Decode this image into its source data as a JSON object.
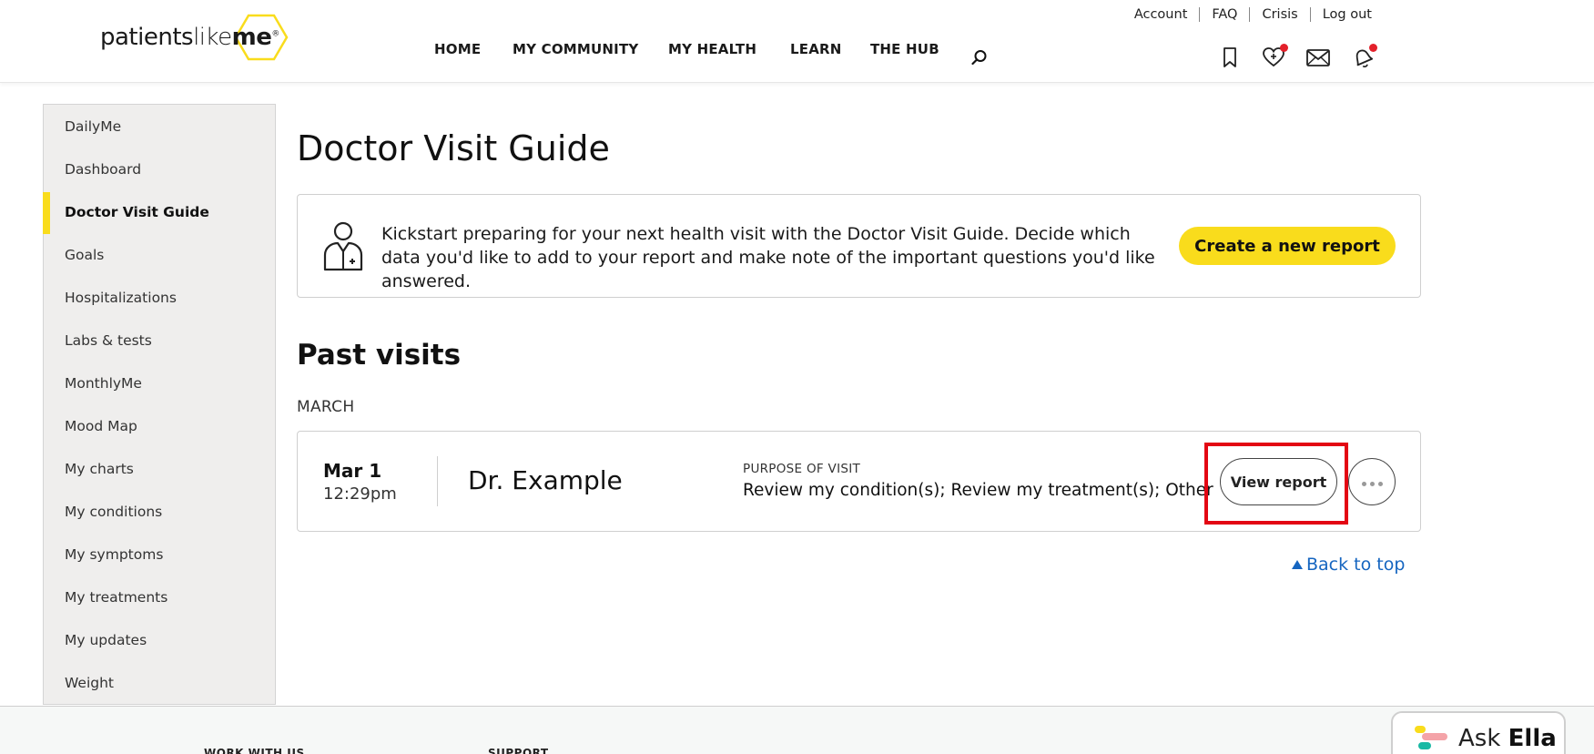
{
  "header": {
    "logo": {
      "part1": "patients",
      "part2": "like",
      "part3": "me",
      "mark": "®"
    },
    "util_links": [
      "Account",
      "FAQ",
      "Crisis",
      "Log out"
    ],
    "nav": [
      "HOME",
      "MY COMMUNITY",
      "MY HEALTH",
      "LEARN",
      "THE HUB"
    ],
    "icons": [
      "bookmark-icon",
      "heart-plus-icon",
      "mail-icon",
      "bell-icon"
    ]
  },
  "sidebar": {
    "items": [
      "DailyMe",
      "Dashboard",
      "Doctor Visit Guide",
      "Goals",
      "Hospitalizations",
      "Labs & tests",
      "MonthlyMe",
      "Mood Map",
      "My charts",
      "My conditions",
      "My symptoms",
      "My treatments",
      "My updates",
      "Weight"
    ],
    "active": "Doctor Visit Guide"
  },
  "main": {
    "title": "Doctor Visit Guide",
    "intro": "Kickstart preparing for your next health visit with the Doctor Visit Guide. Decide which data you'd like to add to your report and make note of the important questions you'd like answered.",
    "create_button": "Create a new report",
    "past_title": "Past visits",
    "month": "MARCH",
    "visit": {
      "date": "Mar 1",
      "time": "12:29pm",
      "doctor": "Dr. Example",
      "purpose_label": "PURPOSE OF VISIT",
      "purpose": "Review my condition(s); Review my treatment(s); Other",
      "view_button": "View report"
    },
    "back_to_top": "Back to top"
  },
  "footer": {
    "headings": [
      "WORK WITH US",
      "SUPPORT"
    ]
  },
  "ask_ella": {
    "prefix": "Ask",
    "name": "Ella"
  },
  "colors": {
    "brand_yellow": "#f9dc1c",
    "link_blue": "#1565c0",
    "highlight_red": "#e30613",
    "notification_red": "#e3202a"
  }
}
